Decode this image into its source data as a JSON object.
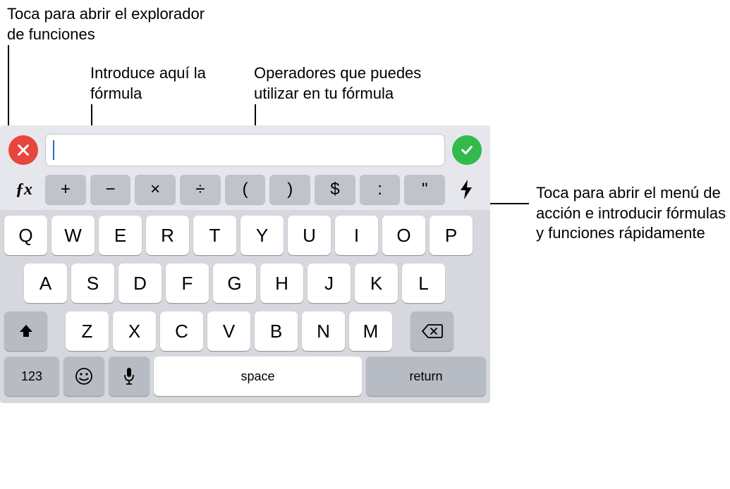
{
  "callouts": {
    "fx": "Toca para abrir el explorador de funciones",
    "formula": "Introduce aquí la fórmula",
    "operators": "Operadores que puedes utilizar en tu fórmula",
    "bolt": "Toca para abrir el menú de acción e introducir fórmulas y funciones rápidamente"
  },
  "fx_label": "ƒx",
  "operators": [
    "+",
    "−",
    "×",
    "÷",
    "(",
    ")",
    "$",
    ":",
    "\""
  ],
  "rows": {
    "r1": [
      "Q",
      "W",
      "E",
      "R",
      "T",
      "Y",
      "U",
      "I",
      "O",
      "P"
    ],
    "r2": [
      "A",
      "S",
      "D",
      "F",
      "G",
      "H",
      "J",
      "K",
      "L"
    ],
    "r3": [
      "Z",
      "X",
      "C",
      "V",
      "B",
      "N",
      "M"
    ]
  },
  "bottom": {
    "num": "123",
    "space": "space",
    "ret": "return"
  }
}
